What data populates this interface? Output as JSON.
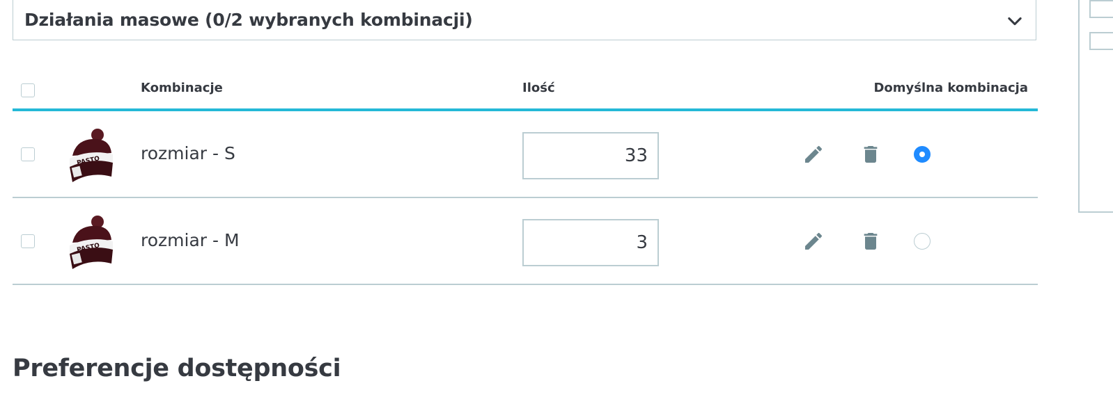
{
  "bulk_actions": {
    "label": "Działania masowe (0/2 wybranych kombinacji)",
    "icon": "chevron-down-icon"
  },
  "table": {
    "headers": {
      "combination": "Kombinacje",
      "quantity": "Ilość",
      "default_combination": "Domyślna kombinacja"
    },
    "rows": [
      {
        "name": "rozmiar - S",
        "quantity": "33",
        "is_default": true
      },
      {
        "name": "rozmiar - M",
        "quantity": "3",
        "is_default": false
      }
    ]
  },
  "section": {
    "title": "Preferencje dostępności"
  },
  "colors": {
    "accent": "#25b9d7",
    "radio_selected": "#1f8bff",
    "icon_gray": "#6c868e",
    "border": "#bbcdd2",
    "text": "#363a41"
  }
}
